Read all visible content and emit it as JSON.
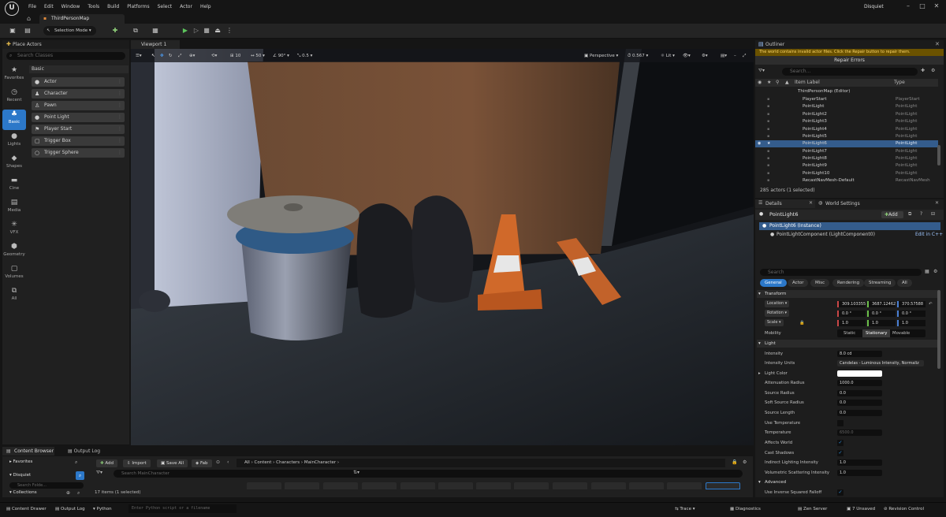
{
  "app": {
    "project": "Disquiet",
    "doc_tab": "ThirdPersonMap"
  },
  "menu": [
    "File",
    "Edit",
    "Window",
    "Tools",
    "Build",
    "Platforms",
    "Select",
    "Actor",
    "Help"
  ],
  "toolbar": {
    "selection_mode": "Selection Mode"
  },
  "place_actors": {
    "title": "Place Actors",
    "search_placeholder": "Search Classes",
    "categories": [
      "Favorites",
      "Recent",
      "Basic",
      "Lights",
      "Shapes",
      "Cine",
      "Media",
      "VFX",
      "Geometry",
      "Volumes",
      "All"
    ],
    "selected_category": "Basic",
    "section": "Basic",
    "items": [
      "Actor",
      "Character",
      "Pawn",
      "Point Light",
      "Player Start",
      "Trigger Box",
      "Trigger Sphere"
    ]
  },
  "viewport": {
    "tab": "Viewport 1",
    "snap_translate": "10",
    "snap_rotate": "50",
    "snap_angle": "90°",
    "snap_scale": "0.5",
    "view_mode": "Perspective",
    "camera_speed": "0.567",
    "lighting": "Lit"
  },
  "outliner": {
    "title": "Outliner",
    "warning": "The world contains invalid actor files. Click the Repair button to repair them.",
    "repair_button": "Repair Errors",
    "search_placeholder": "Search...",
    "col_label": "Item Label",
    "col_type": "Type",
    "rows": [
      {
        "label": "ThirdPersonMap (Editor)",
        "type": ""
      },
      {
        "label": "PlayerStart",
        "type": "PlayerStart"
      },
      {
        "label": "PointLight",
        "type": "PointLight"
      },
      {
        "label": "PointLight2",
        "type": "PointLight"
      },
      {
        "label": "PointLight3",
        "type": "PointLight"
      },
      {
        "label": "PointLight4",
        "type": "PointLight"
      },
      {
        "label": "PointLight5",
        "type": "PointLight"
      },
      {
        "label": "PointLight6",
        "type": "PointLight"
      },
      {
        "label": "PointLight7",
        "type": "PointLight"
      },
      {
        "label": "PointLight8",
        "type": "PointLight"
      },
      {
        "label": "PointLight9",
        "type": "PointLight"
      },
      {
        "label": "PointLight10",
        "type": "PointLight"
      },
      {
        "label": "RecastNavMesh-Default",
        "type": "RecastNavMesh"
      }
    ],
    "count": "285 actors (1 selected)"
  },
  "details": {
    "tab": "Details",
    "tab2": "World Settings",
    "object_name": "PointLight6",
    "add_button": "Add",
    "instance": "PointLight6 (Instance)",
    "component": "PointLightComponent (LightComponent0)",
    "edit_cpp": "Edit in C++",
    "search_placeholder": "Search",
    "filter_tabs": [
      "General",
      "Actor",
      "Misc",
      "Rendering",
      "Streaming",
      "All"
    ],
    "transform_section": "Transform",
    "location_label": "Location",
    "location": [
      "309.103355",
      "3687.12462",
      "370.57588"
    ],
    "rotation_label": "Rotation",
    "rotation": [
      "0.0 °",
      "0.0 °",
      "0.0 °"
    ],
    "scale_label": "Scale",
    "scale": [
      "1.0",
      "1.0",
      "1.0"
    ],
    "mobility_label": "Mobility",
    "mobility": [
      "Static",
      "Stationary",
      "Movable"
    ],
    "light_section": "Light",
    "props": {
      "intensity": {
        "label": "Intensity",
        "value": "8.0 cd"
      },
      "units": {
        "label": "Intensity Units",
        "value": "Candelas - Luminous Intensity, Normaliz"
      },
      "color": {
        "label": "Light Color"
      },
      "atten": {
        "label": "Attenuation Radius",
        "value": "1000.0"
      },
      "source_r": {
        "label": "Source Radius",
        "value": "0.0"
      },
      "soft_r": {
        "label": "Soft Source Radius",
        "value": "0.0"
      },
      "source_l": {
        "label": "Source Length",
        "value": "0.0"
      },
      "use_temp": {
        "label": "Use Temperature"
      },
      "temp": {
        "label": "Temperature",
        "value": "6500.0"
      },
      "affects": {
        "label": "Affects World"
      },
      "shadows": {
        "label": "Cast Shadows"
      },
      "indirect": {
        "label": "Indirect Lighting Intensity",
        "value": "1.0"
      },
      "volumetric": {
        "label": "Volumetric Scattering Intensity",
        "value": "1.0"
      }
    },
    "advanced_section": "Advanced",
    "inverse": {
      "label": "Use Inverse Squared Falloff"
    }
  },
  "content_browser": {
    "tab": "Content Browser",
    "tab2": "Output Log",
    "favorites": "Favorites",
    "project": "Disquiet",
    "search_folders": "Search Folde...",
    "collections": "Collections",
    "add": "Add",
    "import": "Import",
    "save_all": "Save All",
    "fab": "Fab",
    "crumbs": [
      "All",
      "Content",
      "Characters",
      "MainCharacter"
    ],
    "search_placeholder": "Search MainCharacter",
    "items_count": "17 items (1 selected)"
  },
  "statusbar": {
    "content_drawer": "Content Drawer",
    "output_log": "Output Log",
    "cmd": "Python",
    "cmd_placeholder": "Enter Python script or a filename",
    "trace": "Trace",
    "diagnostics": "Diagnostics",
    "zen": "Zen Server",
    "unsaved": "7 Unsaved",
    "revision": "Revision Control"
  }
}
